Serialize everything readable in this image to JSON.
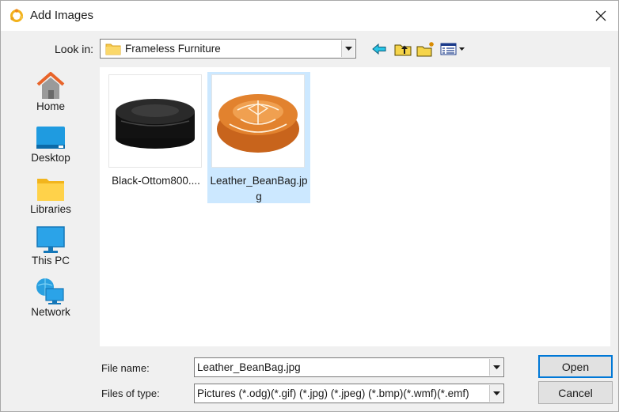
{
  "window": {
    "title": "Add Images",
    "app_icon": "app-logo-icon",
    "close_icon": "close-icon"
  },
  "lookin": {
    "label": "Look in:",
    "value": "Frameless Furniture"
  },
  "toolbar": {
    "icons": [
      "back-arrow-icon",
      "up-folder-icon",
      "new-folder-icon",
      "view-menu-icon"
    ]
  },
  "places": [
    {
      "label": "Home",
      "icon": "home-icon"
    },
    {
      "label": "Desktop",
      "icon": "desktop-icon"
    },
    {
      "label": "Libraries",
      "icon": "libraries-icon"
    },
    {
      "label": "This PC",
      "icon": "this-pc-icon"
    },
    {
      "label": "Network",
      "icon": "network-icon"
    }
  ],
  "files": [
    {
      "name": "Black-Ottom800....",
      "selected": false
    },
    {
      "name": "Leather_BeanBag.jpg",
      "selected": true
    }
  ],
  "filename": {
    "label": "File name:",
    "value": "Leather_BeanBag.jpg"
  },
  "filetype": {
    "label": "Files of type:",
    "value": "Pictures (*.odg)(*.gif) (*.jpg) (*.jpeg) (*.bmp)(*.wmf)(*.emf)"
  },
  "buttons": {
    "open": "Open",
    "cancel": "Cancel"
  },
  "colors": {
    "selection": "#cce8ff",
    "default_button_border": "#0078d7",
    "dialog_bg": "#f0f0f0"
  }
}
